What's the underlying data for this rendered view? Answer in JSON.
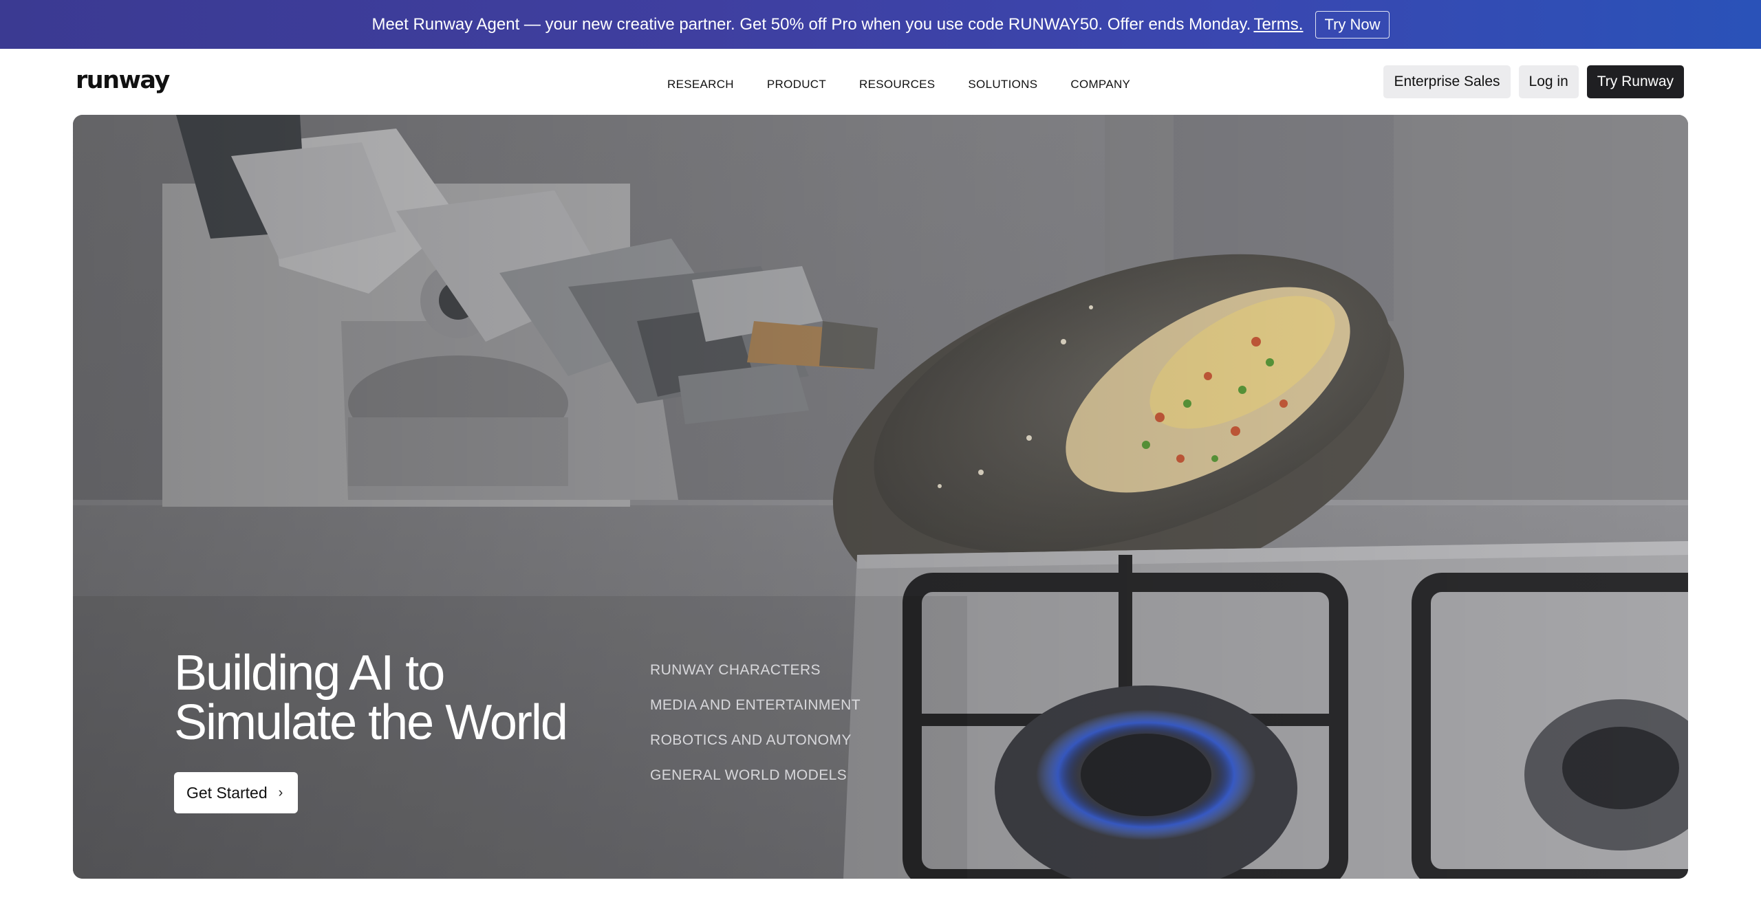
{
  "promo": {
    "message": "Meet Runway Agent — your new creative partner. Get 50% off Pro when you use code RUNWAY50. Offer ends Monday.",
    "terms_label": "Terms.",
    "cta_label": "Try Now"
  },
  "header": {
    "logo": "runway",
    "nav": [
      "RESEARCH",
      "PRODUCT",
      "RESOURCES",
      "SOLUTIONS",
      "COMPANY"
    ],
    "enterprise_label": "Enterprise Sales",
    "login_label": "Log in",
    "try_label": "Try Runway"
  },
  "hero": {
    "title_line1": "Building AI to",
    "title_line2": "Simulate the World",
    "cta_label": "Get Started",
    "cta_icon": "chevron-right-icon",
    "topics": [
      "RUNWAY CHARACTERS",
      "MEDIA AND ENTERTAINMENT",
      "ROBOTICS AND AUTONOMY",
      "GENERAL WORLD MODELS"
    ],
    "image_subject": "robot arm tossing fried rice in a wok over a gas stove"
  },
  "colors": {
    "promo_start": "#3b3a92",
    "promo_end": "#2a52b8",
    "try_runway_bg": "#1f1f22",
    "light_button_bg": "#ececee"
  }
}
